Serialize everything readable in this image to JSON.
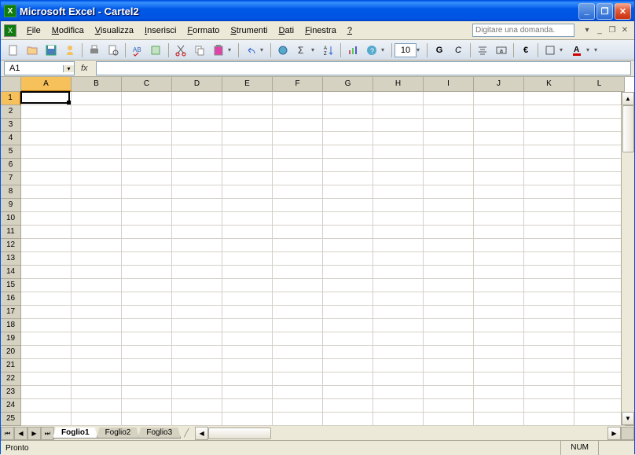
{
  "window": {
    "title": "Microsoft Excel - Cartel2"
  },
  "menu": {
    "items": [
      {
        "label": "File",
        "u": "F"
      },
      {
        "label": "Modifica",
        "u": "M"
      },
      {
        "label": "Visualizza",
        "u": "V"
      },
      {
        "label": "Inserisci",
        "u": "I"
      },
      {
        "label": "Formato",
        "u": "F"
      },
      {
        "label": "Strumenti",
        "u": "S"
      },
      {
        "label": "Dati",
        "u": "D"
      },
      {
        "label": "Finestra",
        "u": "F"
      },
      {
        "label": "?",
        "u": "?"
      }
    ],
    "help_placeholder": "Digitare una domanda."
  },
  "toolbar": {
    "font_size": "10",
    "bold": "G",
    "italic": "C"
  },
  "formula": {
    "namebox": "A1",
    "fx": "fx",
    "value": ""
  },
  "grid": {
    "columns": [
      "A",
      "B",
      "C",
      "D",
      "E",
      "F",
      "G",
      "H",
      "I",
      "J",
      "K",
      "L"
    ],
    "rows": [
      "1",
      "2",
      "3",
      "4",
      "5",
      "6",
      "7",
      "8",
      "9",
      "10",
      "11",
      "12",
      "13",
      "14",
      "15",
      "16",
      "17",
      "18",
      "19",
      "20",
      "21",
      "22",
      "23",
      "24",
      "25"
    ],
    "active": {
      "col": 0,
      "row": 0
    }
  },
  "sheets": {
    "tabs": [
      "Foglio1",
      "Foglio2",
      "Foglio3"
    ],
    "active": 0
  },
  "status": {
    "ready": "Pronto",
    "num": "NUM"
  }
}
